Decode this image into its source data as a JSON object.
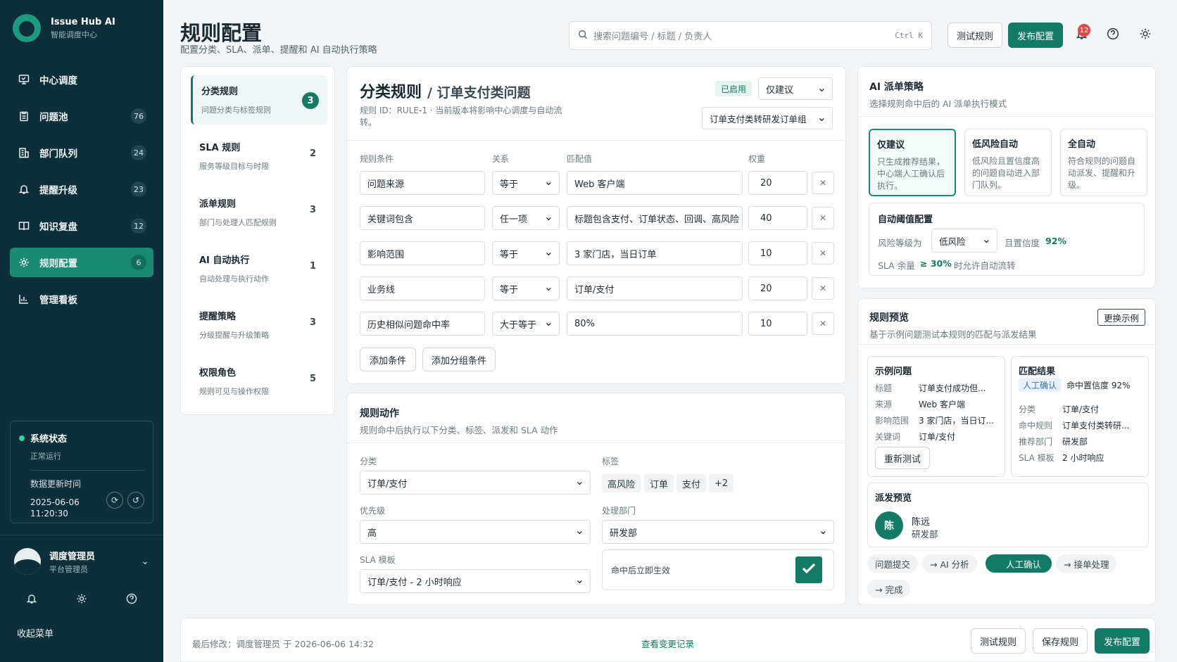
{
  "brand": {
    "title": "Issue Hub AI",
    "subtitle": "智能调度中心"
  },
  "nav": [
    {
      "label": "中心调度",
      "count": "",
      "icon": "monitor-icon"
    },
    {
      "label": "问题池",
      "count": "76",
      "icon": "clipboard-icon"
    },
    {
      "label": "部门队列",
      "count": "24",
      "icon": "building-icon"
    },
    {
      "label": "提醒升级",
      "count": "23",
      "icon": "bell-icon"
    },
    {
      "label": "知识复盘",
      "count": "12",
      "icon": "book-icon"
    },
    {
      "label": "规则配置",
      "count": "6",
      "icon": "gear-icon"
    },
    {
      "label": "管理看板",
      "count": "",
      "icon": "chart-icon"
    }
  ],
  "system": {
    "title": "系统状态",
    "state": "正常运行",
    "update_label": "数据更新时间",
    "update_time": "2025-06-06 11:20:30"
  },
  "user": {
    "name": "调度管理员",
    "role": "平台管理员"
  },
  "collapse_label": "收起菜单",
  "header": {
    "title": "规则配置",
    "subtitle": "配置分类、SLA、派单、提醒和 AI 自动执行策略",
    "search_placeholder": "搜索问题编号 / 标题 / 负责人",
    "shortcut": "Ctrl K",
    "test_label": "测试规则",
    "publish_label": "发布配置",
    "notify_count": "12"
  },
  "categories": [
    {
      "name": "分类规则",
      "desc": "问题分类与标签规则",
      "count": "3"
    },
    {
      "name": "SLA 规则",
      "desc": "服务等级目标与时限",
      "count": "2"
    },
    {
      "name": "派单规则",
      "desc": "部门与处理人匹配规则",
      "count": "3"
    },
    {
      "name": "AI 自动执行",
      "desc": "自动处理与执行动作",
      "count": "1"
    },
    {
      "name": "提醒策略",
      "desc": "分级提醒与升级策略",
      "count": "3"
    },
    {
      "name": "权限角色",
      "desc": "规则可见与操作权限",
      "count": "5"
    }
  ],
  "rule": {
    "title": "分类规则",
    "subtitle": "/ 订单支付类问题",
    "status": "已启用",
    "mode_select": "仅建议",
    "desc": "规则 ID：RULE-1 · 当前版本将影响中心调度与自动流转。",
    "target_select": "订单支付类转研发订单组",
    "headers": {
      "condition": "规则条件",
      "relation": "关系",
      "value": "匹配值",
      "weight": "权重"
    },
    "rows": [
      {
        "condition": "问题来源",
        "relation": "等于",
        "value": "Web 客户端",
        "weight": "20"
      },
      {
        "condition": "关键词包含",
        "relation": "任一项",
        "value": "标题包含支付、订单状态、回调、高风险",
        "weight": "40"
      },
      {
        "condition": "影响范围",
        "relation": "等于",
        "value": "3 家门店，当日订单",
        "weight": "10"
      },
      {
        "condition": "业务线",
        "relation": "等于",
        "value": "订单/支付",
        "weight": "20"
      },
      {
        "condition": "历史相似问题命中率",
        "relation": "大于等于",
        "value": "80%",
        "weight": "10"
      }
    ],
    "add_condition": "添加条件",
    "add_group": "添加分组条件"
  },
  "actions": {
    "title": "规则动作",
    "subtitle": "规则命中后执行以下分类、标签、派发和 SLA 动作",
    "category_label": "分类",
    "category_value": "订单/支付",
    "tags_label": "标签",
    "tags": [
      "高风险",
      "订单",
      "支付",
      "+2"
    ],
    "priority_label": "优先级",
    "priority_value": "高",
    "dept_label": "处理部门",
    "dept_value": "研发部",
    "sla_label": "SLA 模板",
    "sla_value": "订单/支付 - 2 小时响应",
    "immediate_label": "命中后立即生效"
  },
  "ai": {
    "title": "AI 派单策略",
    "subtitle": "选择规则命中后的 AI 派单执行模式",
    "modes": [
      {
        "title": "仅建议",
        "desc": "只生成推荐结果，中心端人工确认后执行。"
      },
      {
        "title": "低风险自动",
        "desc": "低风险且置信度高的问题自动进入部门队列。"
      },
      {
        "title": "全自动",
        "desc": "符合规则的问题自动派发、提醒和升级。"
      }
    ],
    "threshold_title": "自动阈值配置",
    "risk_label": "风险等级为",
    "risk_value": "低风险",
    "conf_label": "且置信度",
    "conf_value": "92%",
    "sla_label": "SLA 余量",
    "sla_value": "≥ 30%",
    "sla_suffix": "时允许自动流转"
  },
  "preview": {
    "title": "规则预览",
    "subtitle": "基于示例问题测试本规则的匹配与派发结果",
    "swap_label": "更换示例",
    "example_title": "示例问题",
    "example": [
      {
        "k": "标题",
        "v": "订单支付成功但..."
      },
      {
        "k": "来源",
        "v": "Web 客户端"
      },
      {
        "k": "影响范围",
        "v": "3 家门店，当日订..."
      },
      {
        "k": "关键词",
        "v": "订单/支付"
      }
    ],
    "retest_label": "重新测试",
    "result_title": "匹配结果",
    "result_badge": "人工确认",
    "result_conf": "命中置信度 92%",
    "result": [
      {
        "k": "分类",
        "v": "订单/支付"
      },
      {
        "k": "命中规则",
        "v": "订单支付类转研..."
      },
      {
        "k": "推荐部门",
        "v": "研发部"
      },
      {
        "k": "SLA 模板",
        "v": "2 小时响应"
      }
    ],
    "dispatch_title": "派发预览",
    "dispatch_avatar": "陈",
    "dispatch_name": "陈远",
    "dispatch_dept": "研发部",
    "flow": [
      "问题提交",
      "→ AI 分析",
      "人工确认",
      "→ 接单处理",
      "→ 完成"
    ]
  },
  "footer": {
    "last_modified": "最后修改：调度管理员 于 2026-06-06 14:32",
    "history_link": "查看变更记录",
    "test_label": "测试规则",
    "save_label": "保存规则",
    "publish_label": "发布配置"
  },
  "colors": {
    "sidebar": "#0d2f3a",
    "accent": "#137a66"
  }
}
